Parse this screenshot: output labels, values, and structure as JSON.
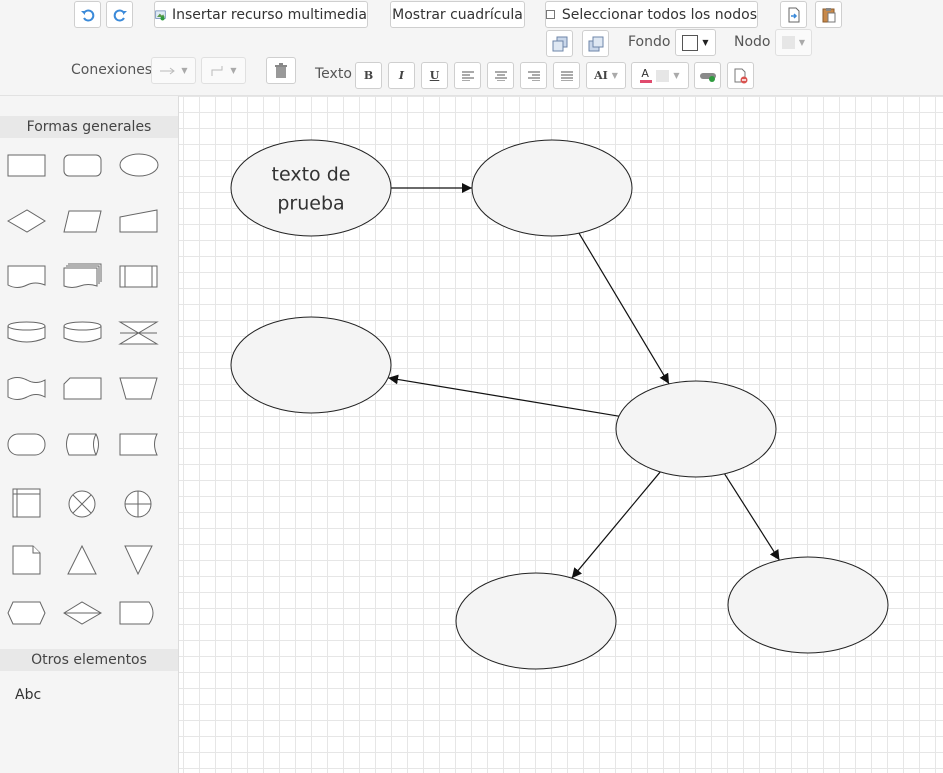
{
  "toolbar": {
    "insert_media_label": "Insertar recurso multimedia",
    "show_grid_label": "Mostrar cuadrícula",
    "select_all_label": "Seleccionar todos los nodos",
    "fondo_label": "Fondo",
    "nodo_label": "Nodo",
    "conexiones_label": "Conexiones",
    "texto_label": "Texto",
    "bold": "B",
    "italic": "I",
    "underline": "U",
    "font_size": "AI",
    "font_color": "A",
    "accent_color": "#4a90e2",
    "fondo_color": "#ffffff"
  },
  "sidebar": {
    "general_shapes_title": "Formas generales",
    "other_elements_title": "Otros elementos",
    "text_element": "Abc",
    "shapes": [
      "rectangle",
      "rounded-rectangle",
      "ellipse",
      "rhombus",
      "parallelogram",
      "manual-input",
      "document",
      "multi-document",
      "subprocess",
      "horizontal-cylinder",
      "cylinder",
      "collate",
      "tape",
      "card",
      "trapezoid",
      "terminator",
      "horizontal-cylinder-2",
      "delay-right",
      "internal-storage",
      "sum-junction",
      "or-junction",
      "note",
      "triangle-up",
      "triangle-down",
      "hexagon",
      "sort",
      "delay"
    ]
  },
  "diagram": {
    "node_fill": "#f4f4f4",
    "node_stroke": "#222222",
    "edge_color": "#111111",
    "nodes": [
      {
        "id": "n1",
        "lines": [
          "texto de",
          "prueba"
        ]
      },
      {
        "id": "n2",
        "lines": []
      },
      {
        "id": "n3",
        "lines": []
      },
      {
        "id": "n4",
        "lines": []
      },
      {
        "id": "n5",
        "lines": []
      },
      {
        "id": "n6",
        "lines": []
      }
    ],
    "edges": [
      {
        "from": "n1",
        "to": "n2"
      },
      {
        "from": "n2",
        "to": "n4"
      },
      {
        "from": "n4",
        "to": "n3"
      },
      {
        "from": "n4",
        "to": "n5"
      },
      {
        "from": "n4",
        "to": "n6"
      }
    ]
  }
}
